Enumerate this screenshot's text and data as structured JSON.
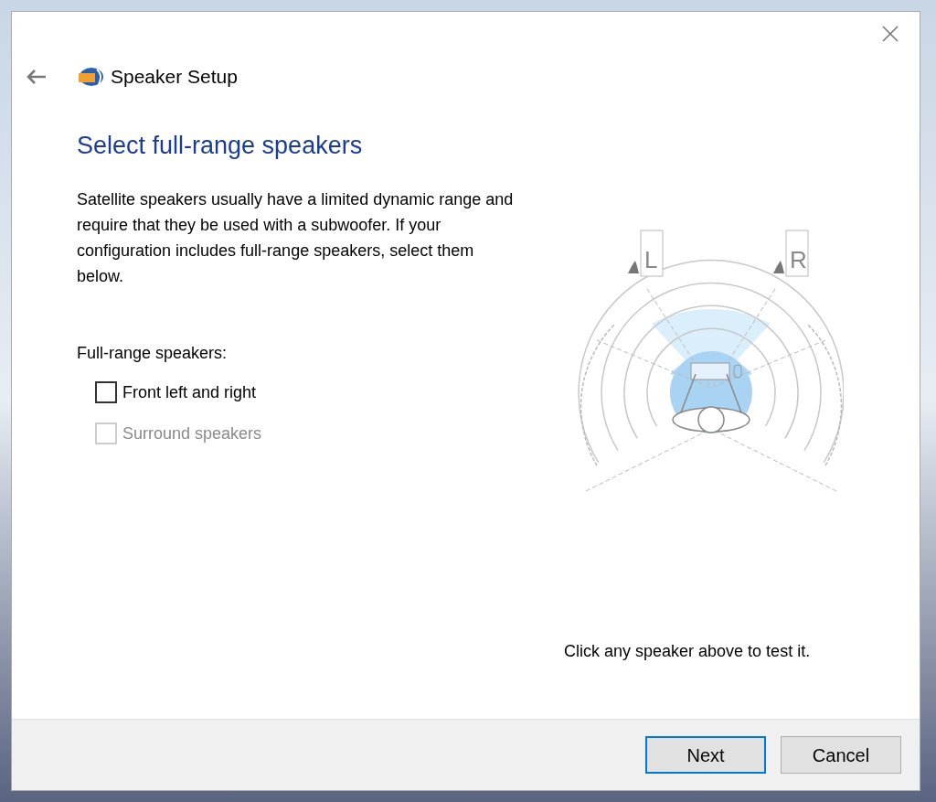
{
  "window": {
    "title": "Speaker Setup"
  },
  "heading": "Select full-range speakers",
  "description": "Satellite speakers usually have a limited dynamic range and require that they be used with a subwoofer.  If your configuration includes full-range speakers, select them below.",
  "group_label": "Full-range speakers:",
  "options": [
    {
      "label": "Front left and right",
      "checked": false,
      "disabled": false
    },
    {
      "label": "Surround speakers",
      "checked": false,
      "disabled": true
    }
  ],
  "diagram": {
    "speakers": [
      {
        "label": "L"
      },
      {
        "label": "R"
      }
    ]
  },
  "hint": "Click any speaker above to test it.",
  "buttons": [
    {
      "label": "Next",
      "focused": true
    },
    {
      "label": "Cancel",
      "focused": false
    }
  ]
}
